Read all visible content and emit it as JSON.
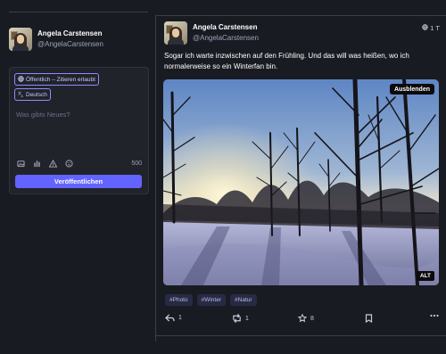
{
  "user": {
    "name": "Angela Carstensen",
    "handle": "@AngelaCarstensen"
  },
  "compose": {
    "visibility": "Öffentlich – Zitieren erlaubt",
    "language": "Deutsch",
    "placeholder": "Was gibts Neues?",
    "char_count": "500",
    "publish_label": "Veröffentlichen",
    "tool_icons": [
      "image-icon",
      "poll-icon",
      "warning-icon",
      "emoji-icon"
    ]
  },
  "post": {
    "author": {
      "name": "Angela Carstensen",
      "handle": "@AngelaCarstensen"
    },
    "time": "1 T",
    "text": "Sogar ich warte inzwischen auf den Frühling. Und das will was heißen, wo ich normalerweise so ein Winterfan bin.",
    "media": {
      "hide_label": "Ausblenden",
      "alt_label": "ALT"
    },
    "tags": [
      "#Photo",
      "#Winter",
      "#Natur"
    ],
    "actions": {
      "replies": "1",
      "boosts": "1",
      "favourites": "8"
    }
  },
  "colors": {
    "background": "#191b22",
    "accent": "#6364ff",
    "card": "#21232b",
    "tag_bg": "#282a44"
  }
}
